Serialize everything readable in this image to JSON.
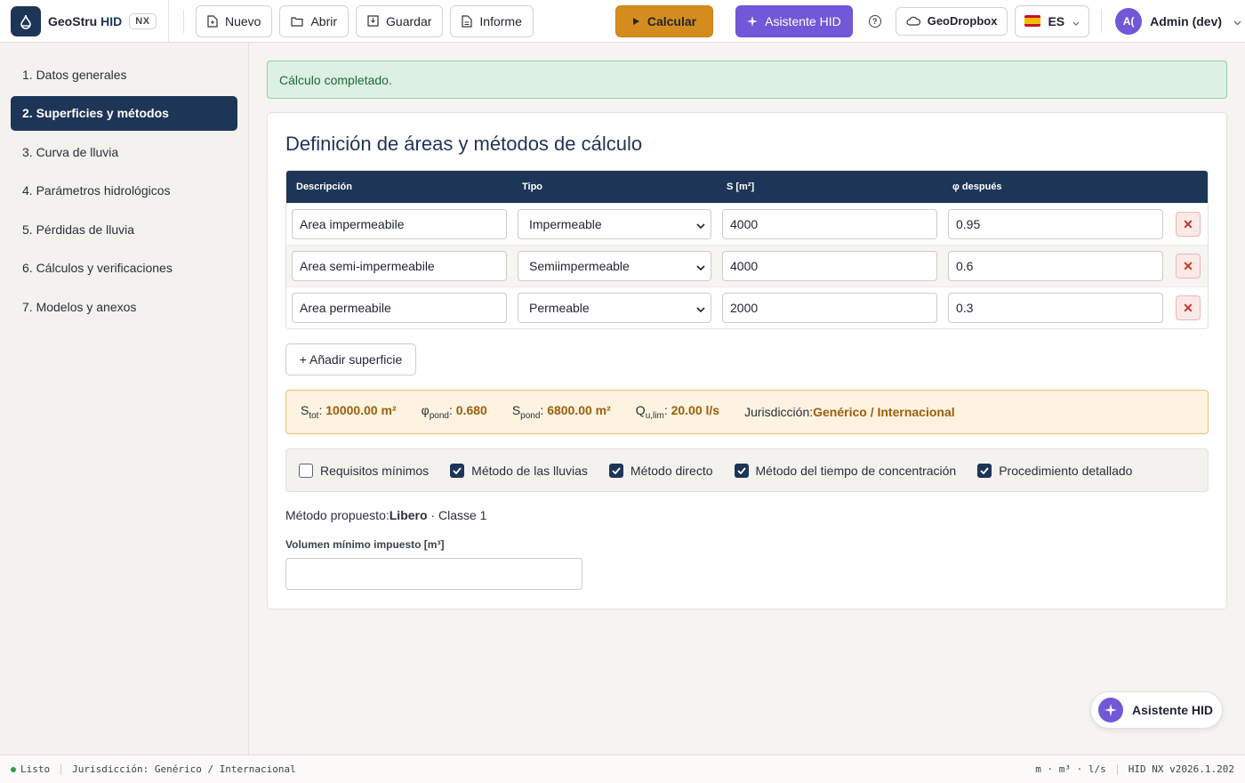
{
  "brand": {
    "name_prefix": "GeoStru",
    "name_suffix": "HID",
    "badge": "NX"
  },
  "toolbar": {
    "nuevo": "Nuevo",
    "abrir": "Abrir",
    "guardar": "Guardar",
    "informe": "Informe",
    "calcular": "Calcular",
    "asistente": "Asistente HID",
    "help": "?",
    "geodropbox": "GeoDropbox",
    "lang": "ES",
    "avatar_initials": "A(",
    "user": "Admin (dev)"
  },
  "sidebar": {
    "items": [
      {
        "label": "1. Datos generales"
      },
      {
        "label": "2. Superficies y métodos"
      },
      {
        "label": "3. Curva de lluvia"
      },
      {
        "label": "4. Parámetros hidrológicos"
      },
      {
        "label": "5. Pérdidas de lluvia"
      },
      {
        "label": "6. Cálculos y verificaciones"
      },
      {
        "label": "7. Modelos y anexos"
      }
    ],
    "active_index": 1
  },
  "alert": {
    "text": "Cálculo completado."
  },
  "card": {
    "title": "Definición de áreas y métodos de cálculo",
    "table": {
      "headers": [
        "Descripción",
        "Tipo",
        "S [m²]",
        "φ después"
      ],
      "rows": [
        {
          "descripcion": "Area impermeabile",
          "tipo": "Impermeable",
          "s": "4000",
          "phi": "0.95"
        },
        {
          "descripcion": "Area semi-impermeabile",
          "tipo": "Semiimpermeable",
          "s": "4000",
          "phi": "0.6"
        },
        {
          "descripcion": "Area permeabile",
          "tipo": "Permeable",
          "s": "2000",
          "phi": "0.3"
        }
      ],
      "delete_glyph": "✕"
    },
    "add_button": "+ Añadir superficie",
    "summary": {
      "stot_label": "S",
      "stot_sub": "tot",
      "stot_value": "10000.00 m²",
      "phi_label": "φ",
      "phi_sub": "pond",
      "phi_value": "0.680",
      "spond_label": "S",
      "spond_sub": "pond",
      "spond_value": "6800.00 m²",
      "q_label": "Q",
      "q_sub": "u,lim",
      "q_value": "20.00 l/s",
      "jur_label": "Jurisdicción:",
      "jur_value": "Genérico / Internacional"
    },
    "methods": [
      {
        "label": "Requisitos mínimos",
        "checked": false
      },
      {
        "label": "Método de las lluvias",
        "checked": true
      },
      {
        "label": "Método directo",
        "checked": true
      },
      {
        "label": "Método del tiempo de concentración",
        "checked": true
      },
      {
        "label": "Procedimiento detallado",
        "checked": true
      }
    ],
    "proposed": {
      "label": "Método propuesto:",
      "method": "Libero",
      "suffix": " · Classe 1"
    },
    "volume": {
      "label": "Volumen mínimo impuesto [m³]",
      "value": ""
    }
  },
  "fab": {
    "label": "Asistente HID"
  },
  "status": {
    "state": "Listo",
    "jurisdiction": "Jurisdicción: Genérico / Internacional",
    "units": "m · m³ · l/s",
    "version": "HID NX v2026.1.202"
  },
  "colors": {
    "primary": "#1d3557",
    "accent": "#d48d1c",
    "assistant": "#7058d8",
    "success": "#dcf0e3",
    "danger": "#c8352b"
  }
}
